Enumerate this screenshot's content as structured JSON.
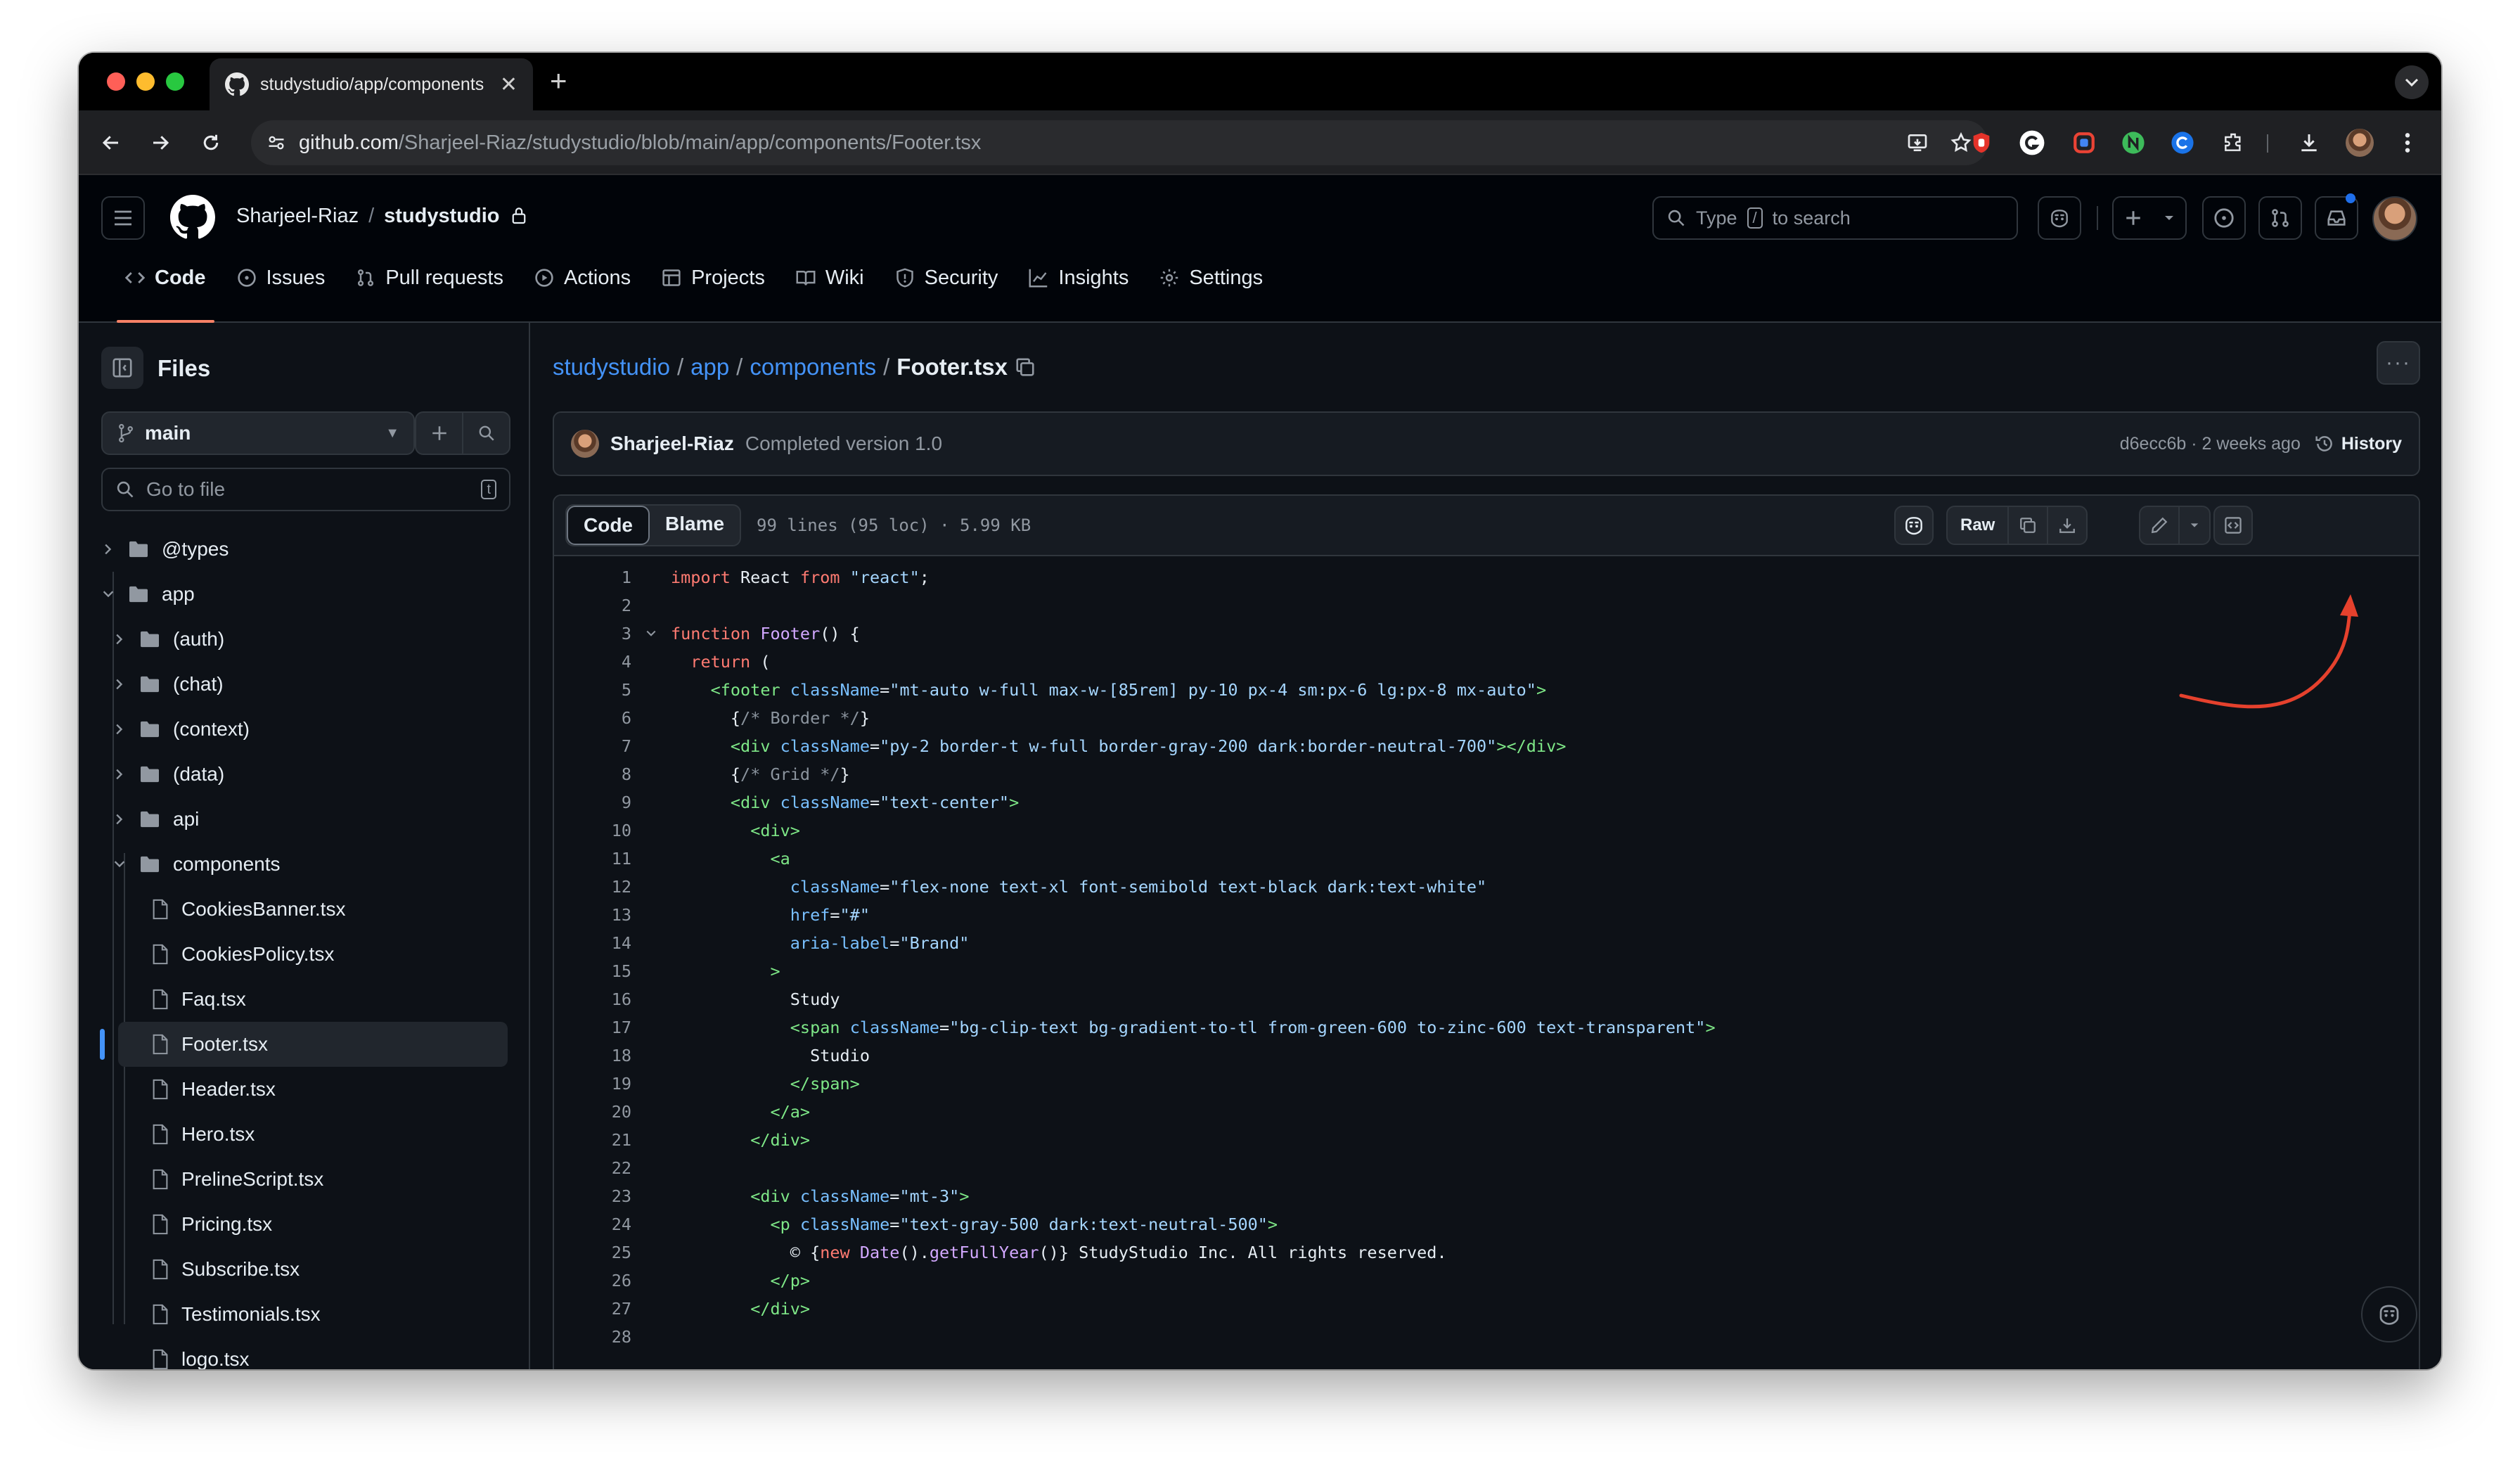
{
  "browser": {
    "tab_title": "studystudio/app/components",
    "url_host": "github.com",
    "url_path": "/Sharjeel-Riaz/studystudio/blob/main/app/components/Footer.tsx"
  },
  "header": {
    "owner": "Sharjeel-Riaz",
    "separator": "/",
    "repo": "studystudio",
    "search_prefix": "Type",
    "search_key": "/",
    "search_suffix": "to search"
  },
  "nav": {
    "tabs": [
      {
        "label": "Code",
        "icon": "code-icon"
      },
      {
        "label": "Issues",
        "icon": "issue-opened-icon"
      },
      {
        "label": "Pull requests",
        "icon": "git-pull-request-icon"
      },
      {
        "label": "Actions",
        "icon": "play-icon"
      },
      {
        "label": "Projects",
        "icon": "table-icon"
      },
      {
        "label": "Wiki",
        "icon": "book-icon"
      },
      {
        "label": "Security",
        "icon": "shield-icon"
      },
      {
        "label": "Insights",
        "icon": "graph-icon"
      },
      {
        "label": "Settings",
        "icon": "gear-icon"
      }
    ]
  },
  "sidebar": {
    "title": "Files",
    "branch": "main",
    "goto_placeholder": "Go to file",
    "goto_key": "t",
    "tree": [
      {
        "name": "@types",
        "type": "folder",
        "open": false,
        "depth": 0
      },
      {
        "name": "app",
        "type": "folder",
        "open": true,
        "depth": 0
      },
      {
        "name": "(auth)",
        "type": "folder",
        "open": false,
        "depth": 1
      },
      {
        "name": "(chat)",
        "type": "folder",
        "open": false,
        "depth": 1
      },
      {
        "name": "(context)",
        "type": "folder",
        "open": false,
        "depth": 1
      },
      {
        "name": "(data)",
        "type": "folder",
        "open": false,
        "depth": 1
      },
      {
        "name": "api",
        "type": "folder",
        "open": false,
        "depth": 1
      },
      {
        "name": "components",
        "type": "folder",
        "open": true,
        "depth": 1
      },
      {
        "name": "CookiesBanner.tsx",
        "type": "file",
        "depth": 2
      },
      {
        "name": "CookiesPolicy.tsx",
        "type": "file",
        "depth": 2
      },
      {
        "name": "Faq.tsx",
        "type": "file",
        "depth": 2
      },
      {
        "name": "Footer.tsx",
        "type": "file",
        "depth": 2,
        "selected": true
      },
      {
        "name": "Header.tsx",
        "type": "file",
        "depth": 2
      },
      {
        "name": "Hero.tsx",
        "type": "file",
        "depth": 2
      },
      {
        "name": "PrelineScript.tsx",
        "type": "file",
        "depth": 2
      },
      {
        "name": "Pricing.tsx",
        "type": "file",
        "depth": 2
      },
      {
        "name": "Subscribe.tsx",
        "type": "file",
        "depth": 2
      },
      {
        "name": "Testimonials.tsx",
        "type": "file",
        "depth": 2
      },
      {
        "name": "logo.tsx",
        "type": "file",
        "depth": 2
      }
    ]
  },
  "path": {
    "repo": "studystudio",
    "dir1": "app",
    "dir2": "components",
    "file": "Footer.tsx",
    "sep": "/"
  },
  "commit": {
    "author": "Sharjeel-Riaz",
    "message": "Completed version 1.0",
    "meta": "d6ecc6b · 2 weeks ago",
    "history": "History"
  },
  "file": {
    "tab_code": "Code",
    "tab_blame": "Blame",
    "meta": "99 lines (95 loc) · 5.99 KB",
    "raw": "Raw"
  },
  "code_lines": [
    {
      "n": "1",
      "fold": false,
      "html": "<span class='k'>import</span> React <span class='k'>from</span> <span class='s'>\"react\"</span>;"
    },
    {
      "n": "2",
      "fold": false,
      "html": ""
    },
    {
      "n": "3",
      "fold": true,
      "html": "<span class='k'>function</span> <span class='f'>Footer</span>() {"
    },
    {
      "n": "4",
      "fold": false,
      "html": "  <span class='k'>return</span> ("
    },
    {
      "n": "5",
      "fold": false,
      "html": "    <span class='t'>&lt;footer</span> <span class='a'>className</span>=<span class='s'>\"mt-auto w-full max-w-[85rem] py-10 px-4 sm:px-6 lg:px-8 mx-auto\"</span><span class='t'>&gt;</span>"
    },
    {
      "n": "6",
      "fold": false,
      "html": "      {<span class='cm'>/* Border */</span>}"
    },
    {
      "n": "7",
      "fold": false,
      "html": "      <span class='t'>&lt;div</span> <span class='a'>className</span>=<span class='s'>\"py-2 border-t w-full border-gray-200 dark:border-neutral-700\"</span><span class='t'>&gt;&lt;/div&gt;</span>"
    },
    {
      "n": "8",
      "fold": false,
      "html": "      {<span class='cm'>/* Grid */</span>}"
    },
    {
      "n": "9",
      "fold": false,
      "html": "      <span class='t'>&lt;div</span> <span class='a'>className</span>=<span class='s'>\"text-center\"</span><span class='t'>&gt;</span>"
    },
    {
      "n": "10",
      "fold": false,
      "html": "        <span class='t'>&lt;div&gt;</span>"
    },
    {
      "n": "11",
      "fold": false,
      "html": "          <span class='t'>&lt;a</span>"
    },
    {
      "n": "12",
      "fold": false,
      "html": "            <span class='a'>className</span>=<span class='s'>\"flex-none text-xl font-semibold text-black dark:text-white\"</span>"
    },
    {
      "n": "13",
      "fold": false,
      "html": "            <span class='a'>href</span>=<span class='s'>\"#\"</span>"
    },
    {
      "n": "14",
      "fold": false,
      "html": "            <span class='a'>aria-label</span>=<span class='s'>\"Brand\"</span>"
    },
    {
      "n": "15",
      "fold": false,
      "html": "          <span class='t'>&gt;</span>"
    },
    {
      "n": "16",
      "fold": false,
      "html": "            Study"
    },
    {
      "n": "17",
      "fold": false,
      "html": "            <span class='t'>&lt;span</span> <span class='a'>className</span>=<span class='s'>\"bg-clip-text bg-gradient-to-tl from-green-600 to-zinc-600 text-transparent\"</span><span class='t'>&gt;</span>"
    },
    {
      "n": "18",
      "fold": false,
      "html": "              Studio"
    },
    {
      "n": "19",
      "fold": false,
      "html": "            <span class='t'>&lt;/span&gt;</span>"
    },
    {
      "n": "20",
      "fold": false,
      "html": "          <span class='t'>&lt;/a&gt;</span>"
    },
    {
      "n": "21",
      "fold": false,
      "html": "        <span class='t'>&lt;/div&gt;</span>"
    },
    {
      "n": "22",
      "fold": false,
      "html": ""
    },
    {
      "n": "23",
      "fold": false,
      "html": "        <span class='t'>&lt;div</span> <span class='a'>className</span>=<span class='s'>\"mt-3\"</span><span class='t'>&gt;</span>"
    },
    {
      "n": "24",
      "fold": false,
      "html": "          <span class='t'>&lt;p</span> <span class='a'>className</span>=<span class='s'>\"text-gray-500 dark:text-neutral-500\"</span><span class='t'>&gt;</span>"
    },
    {
      "n": "25",
      "fold": false,
      "html": "            © {<span class='k'>new</span> <span class='f'>Date</span>().<span class='f'>getFullYear</span>()} StudyStudio Inc. All rights reserved."
    },
    {
      "n": "26",
      "fold": false,
      "html": "          <span class='t'>&lt;/p&gt;</span>"
    },
    {
      "n": "27",
      "fold": false,
      "html": "        <span class='t'>&lt;/div&gt;</span>"
    },
    {
      "n": "28",
      "fold": false,
      "html": ""
    }
  ],
  "colors": {
    "link": "#4493f8",
    "tab_underline": "#f78166",
    "annotation_arrow": "#e5412d"
  }
}
